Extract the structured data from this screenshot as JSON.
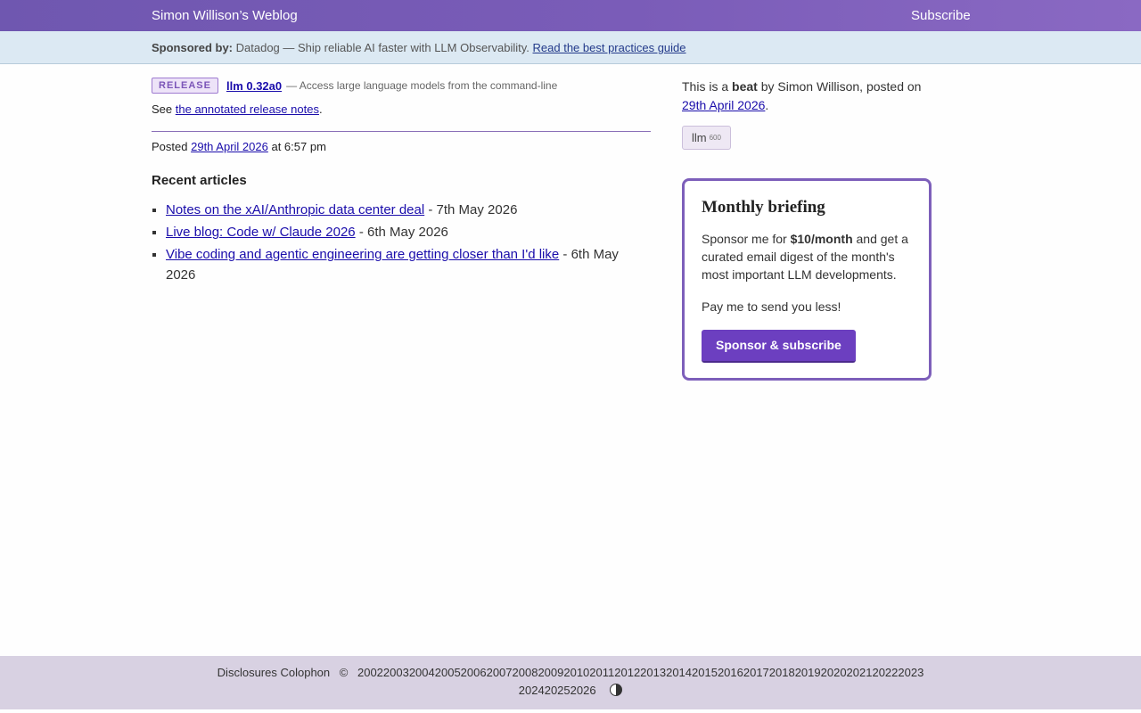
{
  "header": {
    "site_title": "Simon Willison’s Weblog",
    "subscribe": "Subscribe"
  },
  "sponsor": {
    "label": "Sponsored by:",
    "text": "Datadog — Ship reliable AI faster with LLM Observability.",
    "link": "Read the best practices guide"
  },
  "release": {
    "badge": "RELEASE",
    "name": "llm 0.32a0",
    "desc": "— Access large language models from the command-line",
    "see_prefix": "See",
    "see_link": "the annotated release notes",
    "see_suffix": "."
  },
  "posted": {
    "prefix": "Posted",
    "date": "29th April 2026",
    "time": "at 6:57 pm"
  },
  "recent": {
    "heading": "Recent articles",
    "items": [
      {
        "title": "Notes on the xAI/Anthropic data center deal",
        "date": "- 7th May 2026"
      },
      {
        "title": "Live blog: Code w/ Claude 2026",
        "date": "- 6th May 2026"
      },
      {
        "title": "Vibe coding and agentic engineering are getting closer than I'd like",
        "date": "- 6th May 2026"
      }
    ]
  },
  "sidebar": {
    "beat_prefix": "This is a",
    "beat_word": "beat",
    "beat_suffix": "by Simon Willison, posted on",
    "beat_date": "29th April 2026",
    "beat_end": ".",
    "tag_name": "llm",
    "tag_count": "600",
    "briefing": {
      "title": "Monthly briefing",
      "text_prefix": "Sponsor me for",
      "text_price": "$10/month",
      "text_suffix": "and get a curated email digest of the month's most important LLM developments.",
      "text2": "Pay me to send you less!",
      "button": "Sponsor & subscribe"
    }
  },
  "footer": {
    "disclosures": "Disclosures",
    "colophon": "Colophon",
    "copyright": "©",
    "years_row1": [
      "2002",
      "2003",
      "2004",
      "2005",
      "2006",
      "2007",
      "2008",
      "2009",
      "2010",
      "2011",
      "2012",
      "2013",
      "2014",
      "2015",
      "2016",
      "2017",
      "2018",
      "2019",
      "2020",
      "2021",
      "2022",
      "2023"
    ],
    "years_row2": [
      "2024",
      "2025",
      "2026"
    ]
  },
  "colors": {
    "header_bg": "#7a5cb8",
    "sponsor_bg": "#dce9f3",
    "accent": "#6c3fc0",
    "footer_bg": "#d8d1e2"
  }
}
